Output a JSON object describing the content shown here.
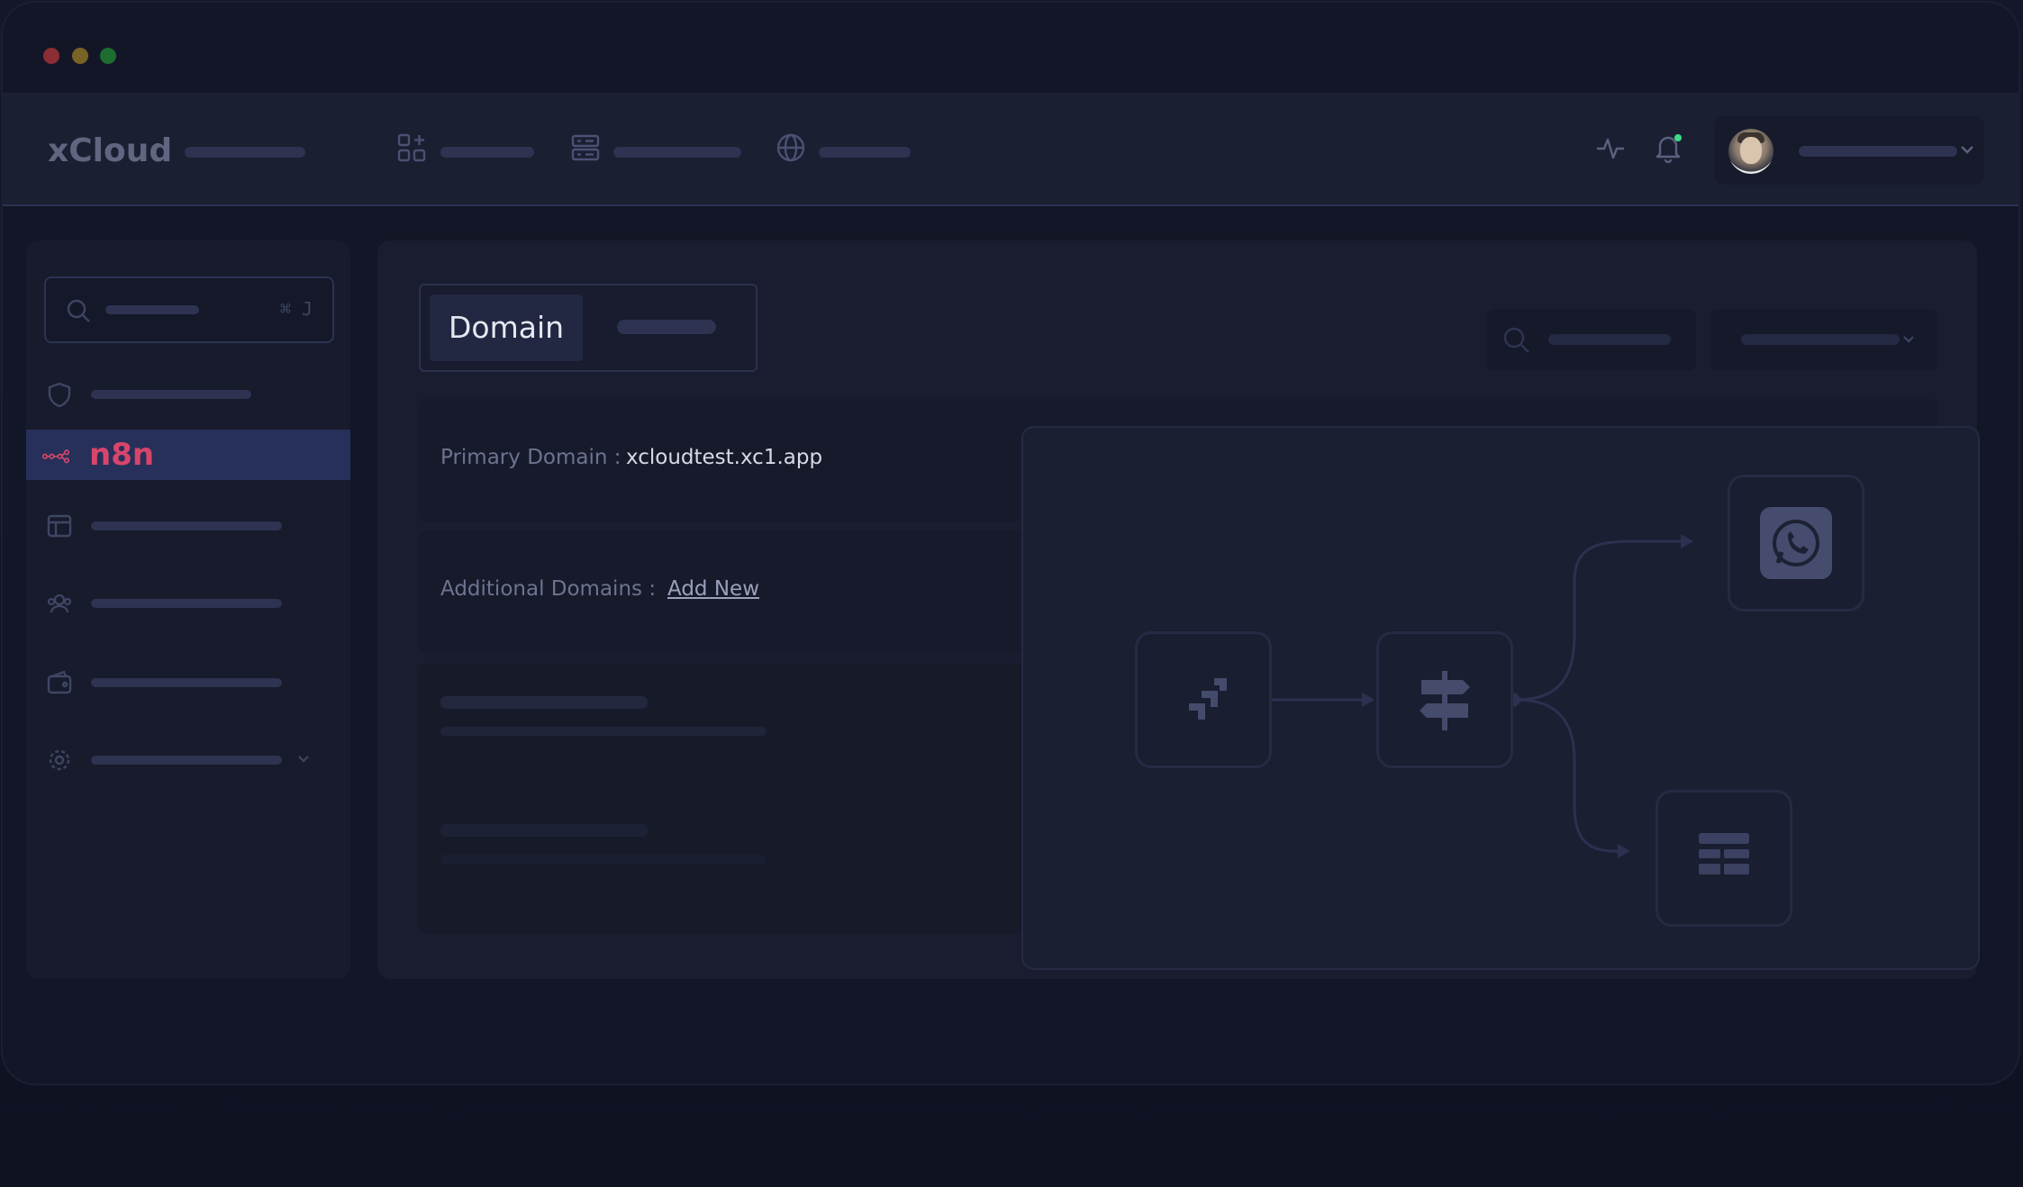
{
  "window": {
    "controls": [
      "close",
      "minimize",
      "maximize"
    ]
  },
  "topnav": {
    "brand": "xCloud",
    "icons": [
      "apps-icon",
      "server-icon",
      "globe-icon",
      "activity-icon",
      "bell-icon",
      "chevron-down-icon"
    ]
  },
  "sidebar": {
    "search_shortcut": "⌘ J",
    "active_item": "n8n"
  },
  "main": {
    "tabs": {
      "active_label": "Domain"
    },
    "primary_domain_label": "Primary Domain :",
    "primary_domain_value": "xcloudtest.xc1.app",
    "additional_domains_label": "Additional Domains :",
    "add_new_label": "Add New"
  },
  "flow": {
    "nodes": [
      "jira-icon",
      "signpost-icon",
      "whatsapp-icon",
      "table-icon"
    ]
  },
  "colors": {
    "accent": "#d8456b",
    "active_bg": "#26305a",
    "status_dot": "#3ddc84"
  }
}
